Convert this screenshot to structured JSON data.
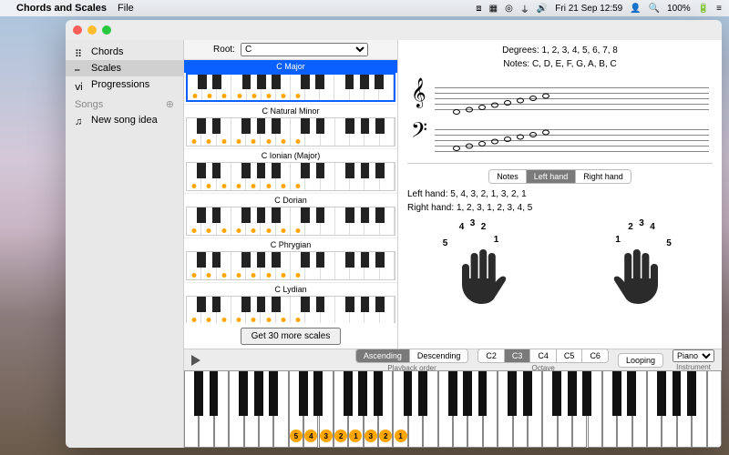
{
  "menubar": {
    "app": "Chords and Scales",
    "menu1": "File",
    "clock": "Fri 21 Sep  12:59",
    "battery": "100%"
  },
  "sidebar": {
    "chords": "Chords",
    "scales": "Scales",
    "progressions": "Progressions",
    "songs_header": "Songs",
    "song1": "New song idea"
  },
  "root": {
    "label": "Root:",
    "value": "C"
  },
  "scales": [
    "C Major",
    "C Natural Minor",
    "C Ionian (Major)",
    "C Dorian",
    "C Phrygian",
    "C Lydian"
  ],
  "get_more": "Get 30 more scales",
  "detail": {
    "degrees_label": "Degrees:",
    "degrees": "1, 2, 3, 4, 5, 6, 7, 8",
    "notes_label": "Notes:",
    "notes": "C, D, E, F, G, A, B, C",
    "tabs": {
      "notes": "Notes",
      "left": "Left hand",
      "right": "Right hand"
    },
    "left_label": "Left hand:",
    "left_fingers": "5, 4, 3, 2, 1, 3, 2, 1",
    "right_label": "Right hand:",
    "right_fingers": "1, 2, 3, 1, 2, 3, 4, 5"
  },
  "controls": {
    "order": {
      "asc": "Ascending",
      "desc": "Descending",
      "label": "Playback order"
    },
    "octaves": [
      "C2",
      "C3",
      "C4",
      "C5",
      "C6"
    ],
    "octave_label": "Octave",
    "looping": "Looping",
    "instrument": "Piano",
    "instrument_label": "Instrument"
  },
  "large_fingers": [
    "5",
    "4",
    "3",
    "2",
    "1",
    "3",
    "2",
    "1"
  ],
  "hand_left_nums": {
    "f1": "1",
    "f2": "2",
    "f3": "3",
    "f4": "4",
    "f5": "5"
  },
  "hand_right_nums": {
    "f1": "1",
    "f2": "2",
    "f3": "3",
    "f4": "4",
    "f5": "5"
  }
}
